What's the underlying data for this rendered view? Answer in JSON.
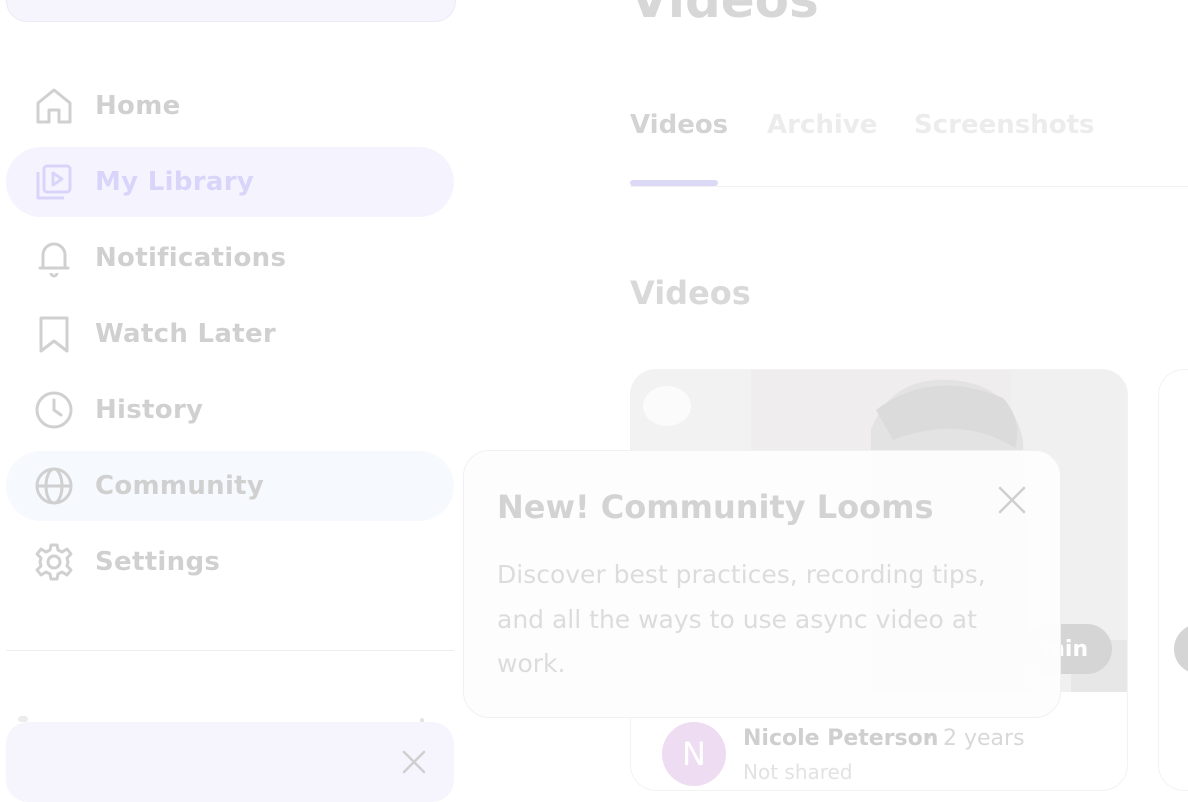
{
  "sidebar": {
    "items": [
      {
        "label": "Home",
        "icon": "home-icon"
      },
      {
        "label": "My Library",
        "icon": "library-icon",
        "state": "active"
      },
      {
        "label": "Notifications",
        "icon": "bell-icon"
      },
      {
        "label": "Watch Later",
        "icon": "bookmark-icon"
      },
      {
        "label": "History",
        "icon": "clock-icon"
      },
      {
        "label": "Community",
        "icon": "globe-icon",
        "state": "highlighted"
      },
      {
        "label": "Settings",
        "icon": "gear-icon"
      }
    ]
  },
  "main": {
    "title": "Videos",
    "tabs": [
      {
        "label": "Videos",
        "active": true
      },
      {
        "label": "Archive"
      },
      {
        "label": "Screenshots"
      }
    ],
    "section_title": "Videos",
    "video": {
      "duration": "min",
      "avatar_initial": "N",
      "owner": "Nicole Peterson",
      "separator": "·",
      "age": "2 years",
      "share_status": "Not shared"
    }
  },
  "popover": {
    "title": "New! Community Looms",
    "body": "Discover best practices, recording tips, and all the ways to use async video at work."
  },
  "colors": {
    "accent": "#dcd9f7",
    "active_bg": "#f5f4fe",
    "avatar": "#eedcf2"
  }
}
